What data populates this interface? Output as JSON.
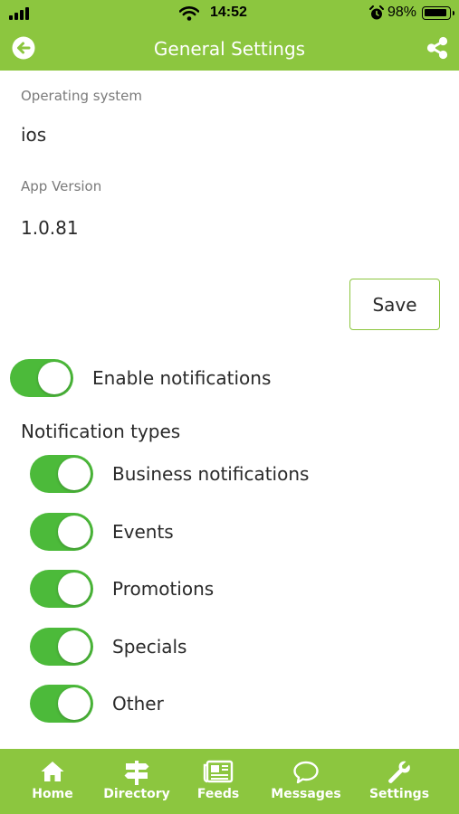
{
  "status_bar": {
    "time": "14:52",
    "battery_percent": "98%"
  },
  "header": {
    "title": "General Settings",
    "back_icon": "arrow-left-circle-icon",
    "share_icon": "share-icon"
  },
  "info": {
    "os_label": "Operating system",
    "os_value": "ios",
    "version_label": "App Version",
    "version_value": "1.0.81"
  },
  "save_label": "Save",
  "enable_notifications": {
    "label": "Enable notifications",
    "on": true
  },
  "notification_types": {
    "title": "Notification types",
    "items": [
      {
        "label": "Business notifications",
        "on": true
      },
      {
        "label": "Events",
        "on": true
      },
      {
        "label": "Promotions",
        "on": true
      },
      {
        "label": "Specials",
        "on": true
      },
      {
        "label": "Other",
        "on": true
      }
    ]
  },
  "bottom_nav": [
    {
      "label": "Home",
      "icon": "home-icon"
    },
    {
      "label": "Directory",
      "icon": "signpost-icon"
    },
    {
      "label": "Feeds",
      "icon": "newspaper-icon"
    },
    {
      "label": "Messages",
      "icon": "chat-bubble-icon"
    },
    {
      "label": "Settings",
      "icon": "wrench-icon"
    }
  ],
  "colors": {
    "brand_green": "#8cc63f",
    "toggle_green": "#4cba3a"
  }
}
